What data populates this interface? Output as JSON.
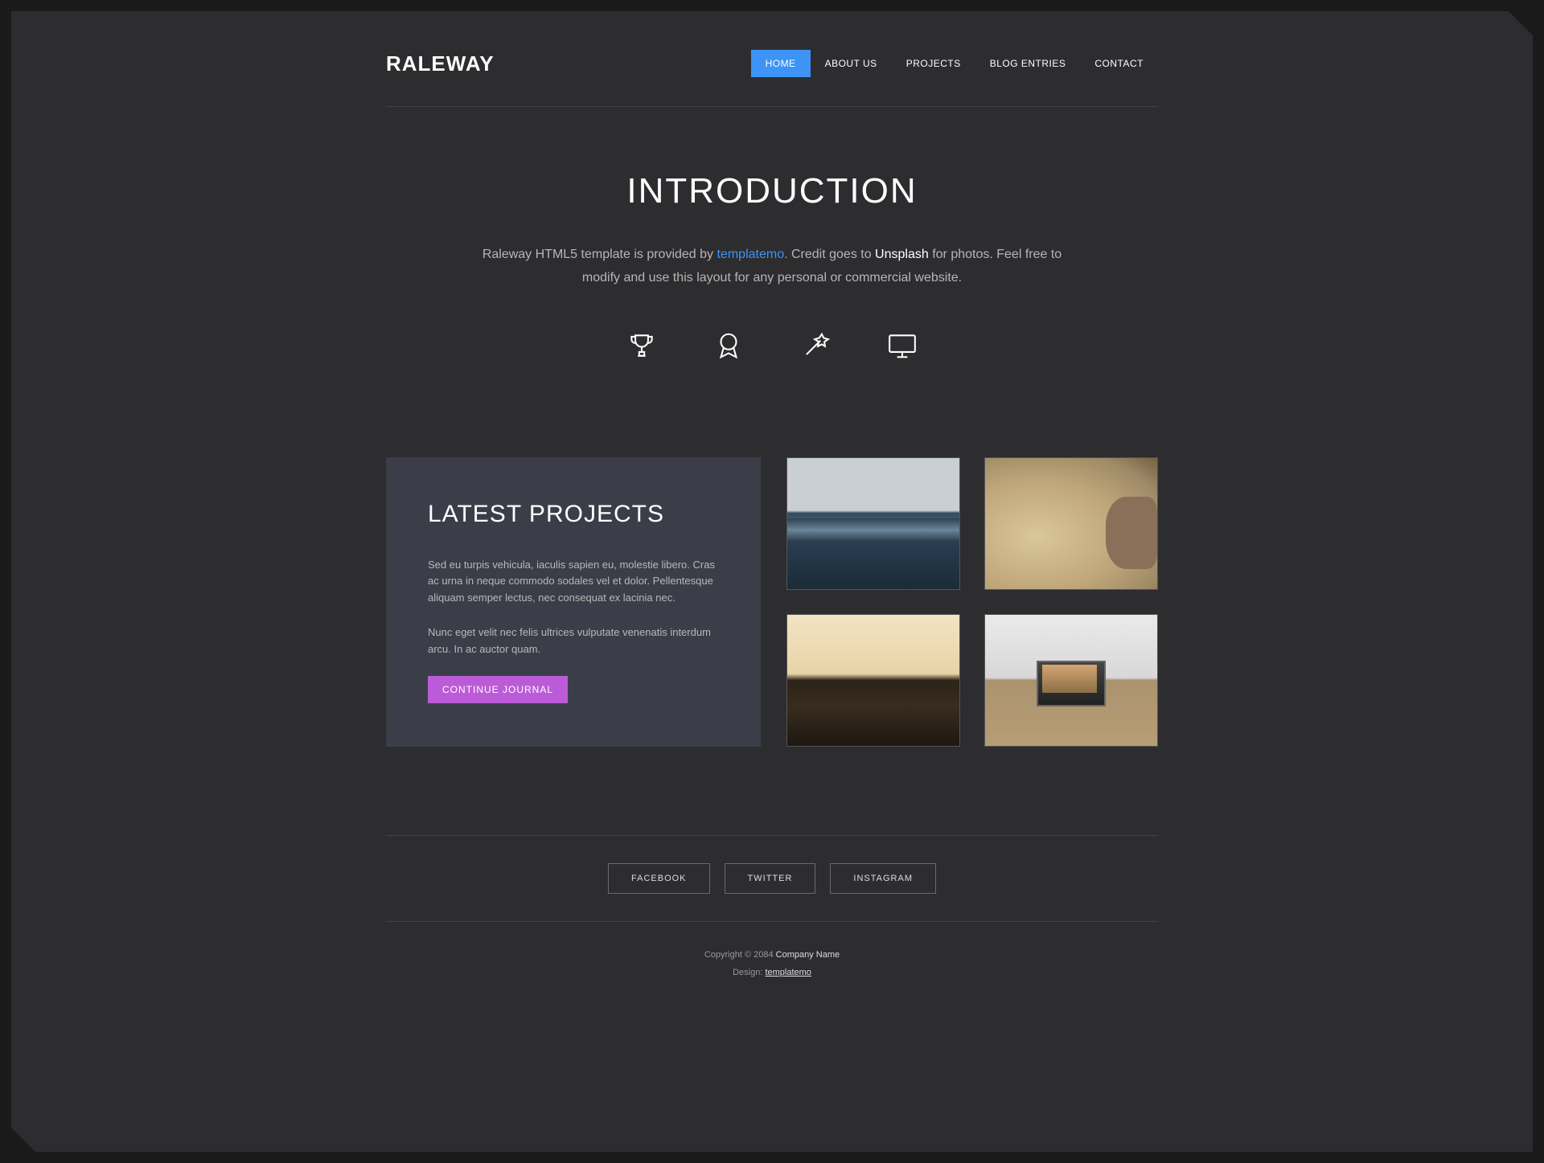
{
  "header": {
    "logo": "RALEWAY",
    "nav": [
      "HOME",
      "ABOUT US",
      "PROJECTS",
      "BLOG ENTRIES",
      "CONTACT"
    ]
  },
  "intro": {
    "title": "INTRODUCTION",
    "lead_a": "Raleway HTML5 template is provided by ",
    "link_tmpl": "templatemo",
    "dot": ".",
    "lead_b": " Credit goes to ",
    "link_unsp": "Unsplash",
    "lead_c": " for photos. Feel free to modify and use this layout for any personal or commercial website."
  },
  "projects": {
    "title": "LATEST PROJECTS",
    "p1": "Sed eu turpis vehicula, iaculis sapien eu, molestie libero. Cras ac urna in neque commodo sodales vel et dolor. Pellentesque aliquam semper lectus, nec consequat ex lacinia nec.",
    "p2": "Nunc eget velit nec felis ultrices vulputate venenatis interdum arcu. In ac auctor quam.",
    "button": "CONTINUE JOURNAL"
  },
  "social": [
    "FACEBOOK",
    "TWITTER",
    "INSTAGRAM"
  ],
  "footer": {
    "copy_a": "Copyright © 2084 ",
    "company": "Company Name",
    "design_a": "Design: ",
    "design_b": "templatemo"
  }
}
